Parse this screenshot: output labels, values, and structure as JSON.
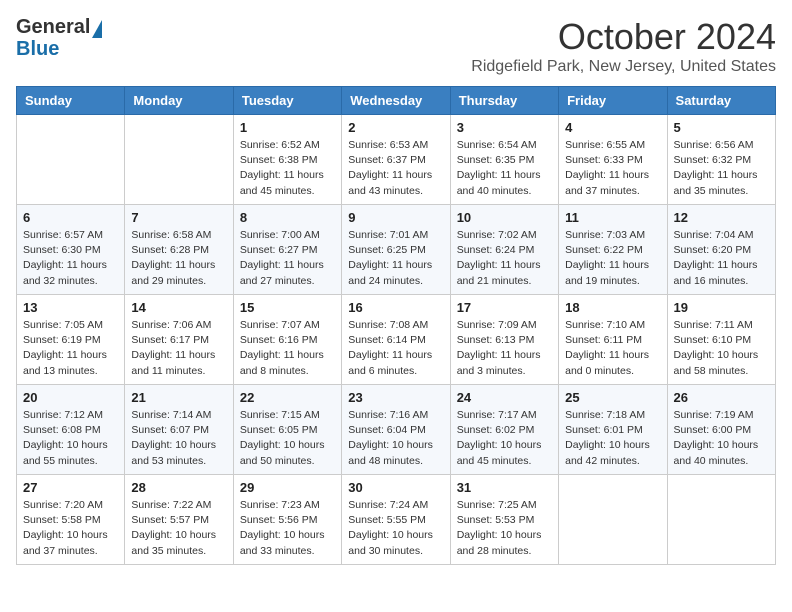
{
  "header": {
    "logo_general": "General",
    "logo_blue": "Blue",
    "title": "October 2024",
    "location": "Ridgefield Park, New Jersey, United States"
  },
  "days_of_week": [
    "Sunday",
    "Monday",
    "Tuesday",
    "Wednesday",
    "Thursday",
    "Friday",
    "Saturday"
  ],
  "weeks": [
    [
      {
        "day": "",
        "info": ""
      },
      {
        "day": "",
        "info": ""
      },
      {
        "day": "1",
        "info": "Sunrise: 6:52 AM\nSunset: 6:38 PM\nDaylight: 11 hours and 45 minutes."
      },
      {
        "day": "2",
        "info": "Sunrise: 6:53 AM\nSunset: 6:37 PM\nDaylight: 11 hours and 43 minutes."
      },
      {
        "day": "3",
        "info": "Sunrise: 6:54 AM\nSunset: 6:35 PM\nDaylight: 11 hours and 40 minutes."
      },
      {
        "day": "4",
        "info": "Sunrise: 6:55 AM\nSunset: 6:33 PM\nDaylight: 11 hours and 37 minutes."
      },
      {
        "day": "5",
        "info": "Sunrise: 6:56 AM\nSunset: 6:32 PM\nDaylight: 11 hours and 35 minutes."
      }
    ],
    [
      {
        "day": "6",
        "info": "Sunrise: 6:57 AM\nSunset: 6:30 PM\nDaylight: 11 hours and 32 minutes."
      },
      {
        "day": "7",
        "info": "Sunrise: 6:58 AM\nSunset: 6:28 PM\nDaylight: 11 hours and 29 minutes."
      },
      {
        "day": "8",
        "info": "Sunrise: 7:00 AM\nSunset: 6:27 PM\nDaylight: 11 hours and 27 minutes."
      },
      {
        "day": "9",
        "info": "Sunrise: 7:01 AM\nSunset: 6:25 PM\nDaylight: 11 hours and 24 minutes."
      },
      {
        "day": "10",
        "info": "Sunrise: 7:02 AM\nSunset: 6:24 PM\nDaylight: 11 hours and 21 minutes."
      },
      {
        "day": "11",
        "info": "Sunrise: 7:03 AM\nSunset: 6:22 PM\nDaylight: 11 hours and 19 minutes."
      },
      {
        "day": "12",
        "info": "Sunrise: 7:04 AM\nSunset: 6:20 PM\nDaylight: 11 hours and 16 minutes."
      }
    ],
    [
      {
        "day": "13",
        "info": "Sunrise: 7:05 AM\nSunset: 6:19 PM\nDaylight: 11 hours and 13 minutes."
      },
      {
        "day": "14",
        "info": "Sunrise: 7:06 AM\nSunset: 6:17 PM\nDaylight: 11 hours and 11 minutes."
      },
      {
        "day": "15",
        "info": "Sunrise: 7:07 AM\nSunset: 6:16 PM\nDaylight: 11 hours and 8 minutes."
      },
      {
        "day": "16",
        "info": "Sunrise: 7:08 AM\nSunset: 6:14 PM\nDaylight: 11 hours and 6 minutes."
      },
      {
        "day": "17",
        "info": "Sunrise: 7:09 AM\nSunset: 6:13 PM\nDaylight: 11 hours and 3 minutes."
      },
      {
        "day": "18",
        "info": "Sunrise: 7:10 AM\nSunset: 6:11 PM\nDaylight: 11 hours and 0 minutes."
      },
      {
        "day": "19",
        "info": "Sunrise: 7:11 AM\nSunset: 6:10 PM\nDaylight: 10 hours and 58 minutes."
      }
    ],
    [
      {
        "day": "20",
        "info": "Sunrise: 7:12 AM\nSunset: 6:08 PM\nDaylight: 10 hours and 55 minutes."
      },
      {
        "day": "21",
        "info": "Sunrise: 7:14 AM\nSunset: 6:07 PM\nDaylight: 10 hours and 53 minutes."
      },
      {
        "day": "22",
        "info": "Sunrise: 7:15 AM\nSunset: 6:05 PM\nDaylight: 10 hours and 50 minutes."
      },
      {
        "day": "23",
        "info": "Sunrise: 7:16 AM\nSunset: 6:04 PM\nDaylight: 10 hours and 48 minutes."
      },
      {
        "day": "24",
        "info": "Sunrise: 7:17 AM\nSunset: 6:02 PM\nDaylight: 10 hours and 45 minutes."
      },
      {
        "day": "25",
        "info": "Sunrise: 7:18 AM\nSunset: 6:01 PM\nDaylight: 10 hours and 42 minutes."
      },
      {
        "day": "26",
        "info": "Sunrise: 7:19 AM\nSunset: 6:00 PM\nDaylight: 10 hours and 40 minutes."
      }
    ],
    [
      {
        "day": "27",
        "info": "Sunrise: 7:20 AM\nSunset: 5:58 PM\nDaylight: 10 hours and 37 minutes."
      },
      {
        "day": "28",
        "info": "Sunrise: 7:22 AM\nSunset: 5:57 PM\nDaylight: 10 hours and 35 minutes."
      },
      {
        "day": "29",
        "info": "Sunrise: 7:23 AM\nSunset: 5:56 PM\nDaylight: 10 hours and 33 minutes."
      },
      {
        "day": "30",
        "info": "Sunrise: 7:24 AM\nSunset: 5:55 PM\nDaylight: 10 hours and 30 minutes."
      },
      {
        "day": "31",
        "info": "Sunrise: 7:25 AM\nSunset: 5:53 PM\nDaylight: 10 hours and 28 minutes."
      },
      {
        "day": "",
        "info": ""
      },
      {
        "day": "",
        "info": ""
      }
    ]
  ]
}
